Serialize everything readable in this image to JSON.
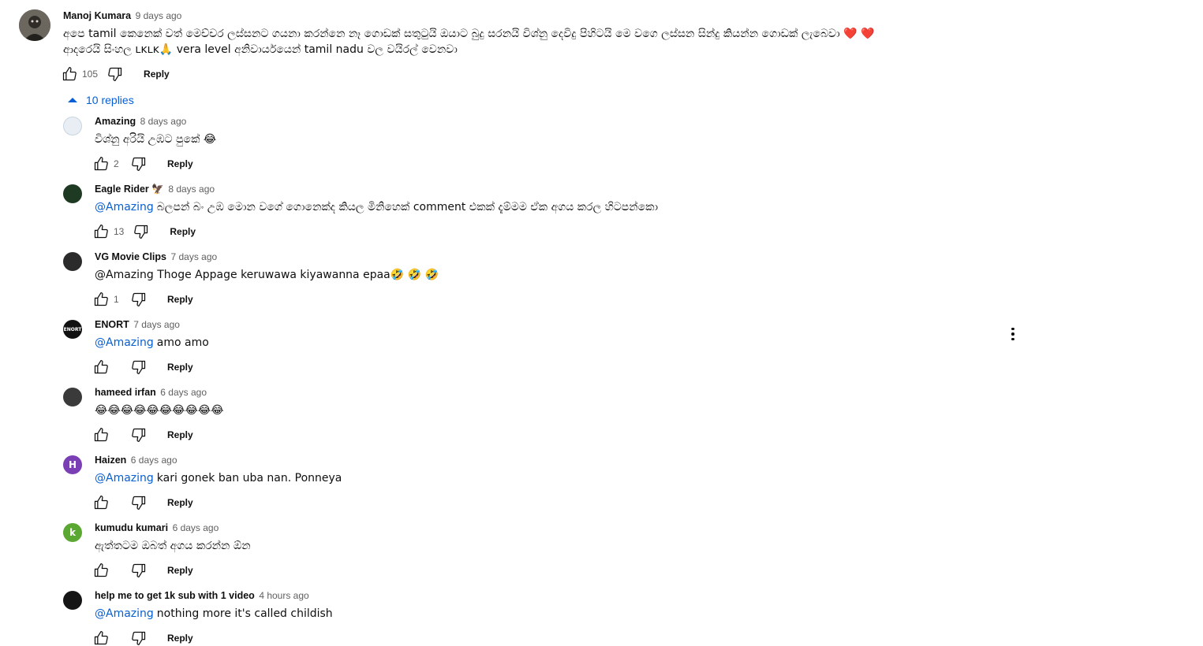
{
  "top_comment": {
    "author": "Manoj Kumara",
    "time": "9 days ago",
    "line1": "අපෙ tamil කෙනෙක් වත් මෙච්චර ලස්සනට ගයනා කරන්නෙ නෑ ගොඩක් සතුටුයි ඔයාට බුදු සරනයි විශ්නු දෙවිදු පිහිටයි මෙ වගෙ ලස්සන සින්දු කියන්න ගොඩක් ලැබෙවා ❤️ ❤️",
    "line2": "ආදරෙයි සිංහල ʟᴋʟᴋ🙏 vera level අනිවාර්යයෙන් tamil nadu වල වයිරල් වෙනවා",
    "likes": "105",
    "reply_label": "Reply"
  },
  "replies_toggle": {
    "label": "10 replies"
  },
  "replies": [
    {
      "author": "Amazing",
      "badge": "",
      "time": "8 days ago",
      "mention": "",
      "text": "විශ්නු අරියි උඹට පුකේ 😂",
      "likes": "2",
      "reply_label": "Reply",
      "avatar_color": "#e8eef3",
      "avatar_letter": ""
    },
    {
      "author": "Eagle Rider",
      "badge": "🦅",
      "time": "8 days ago",
      "mention": "@Amazing",
      "text": "බලපන් බං උඹ මොන වගේ ගොනෙක්ද කියල මිනිහෙක් comment එකක් දැම්මම ඒක අගය කරල හිටපන්කො",
      "likes": "13",
      "reply_label": "Reply",
      "avatar_color": "#1f3a22",
      "avatar_letter": ""
    },
    {
      "author": "VG Movie Clips",
      "badge": "",
      "time": "7 days ago",
      "mention": "",
      "text": "@Amazing Thoge Appage keruwawa kiyawanna epaa🤣 🤣 🤣",
      "likes": "1",
      "reply_label": "Reply",
      "avatar_color": "#2b2b2b",
      "avatar_letter": ""
    },
    {
      "author": "ENORT",
      "badge": "",
      "time": "7 days ago",
      "mention": "@Amazing",
      "text": "amo amo",
      "likes": "",
      "reply_label": "Reply",
      "avatar_color": "#111111",
      "avatar_letter": "ENORT"
    },
    {
      "author": "hameed irfan",
      "badge": "",
      "time": "6 days ago",
      "mention": "",
      "text": "😂😂😂😂😂😂😂😂😂😂",
      "likes": "",
      "reply_label": "Reply",
      "avatar_color": "#3a3a3a",
      "avatar_letter": ""
    },
    {
      "author": "Haizen",
      "badge": "",
      "time": "6 days ago",
      "mention": "@Amazing",
      "text": "kari gonek ban uba nan. Ponneya",
      "likes": "",
      "reply_label": "Reply",
      "avatar_color": "#7b3fb5",
      "avatar_letter": "H"
    },
    {
      "author": "kumudu kumari",
      "badge": "",
      "time": "6 days ago",
      "mention": "",
      "text": "ඇත්තටම ඔබත් අගය කරන්න ඕන",
      "likes": "",
      "reply_label": "Reply",
      "avatar_color": "#5aa832",
      "avatar_letter": "k"
    },
    {
      "author": "help me to get 1k sub with 1 video",
      "badge": "",
      "time": "4 hours ago",
      "mention": "@Amazing",
      "text": "nothing more it's called childish",
      "likes": "",
      "reply_label": "Reply",
      "avatar_color": "#151515",
      "avatar_letter": ""
    }
  ]
}
